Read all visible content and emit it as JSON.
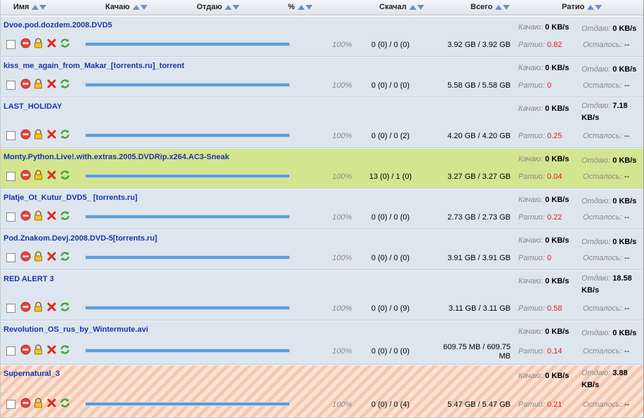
{
  "header": {
    "name": "Имя",
    "down": "Качаю",
    "up": "Отдаю",
    "pct": "%",
    "done": "Скачал",
    "total": "Всего",
    "ratio": "Ратио"
  },
  "labels": {
    "down": "Качаю:",
    "up": "Отдаю:",
    "ratio": "Ратио:",
    "left": "Осталось:"
  },
  "rows": [
    {
      "name": "Dvoe.pod.dozdem.2008.DVD5",
      "down": "0 KB/s",
      "up": "0 KB/s",
      "pct": "100%",
      "peers": "0 (0) / 0 (0)",
      "size": "3.92 GB / 3.92 GB",
      "ratio": "0.82",
      "left": "--",
      "progress": 1.0
    },
    {
      "name": "kiss_me_again_from_Makar_[torrents.ru]_torrent",
      "down": "0 KB/s",
      "up": "0 KB/s",
      "pct": "100%",
      "peers": "0 (0) / 0 (0)",
      "size": "5.58 GB / 5.58 GB",
      "ratio": "0",
      "left": "--",
      "progress": 1.0
    },
    {
      "name": "LAST_HOLIDAY",
      "down": "0 KB/s",
      "up": "7.18 KB/s",
      "pct": "100%",
      "peers": "0 (0) / 0 (2)",
      "size": "4.20 GB / 4.20 GB",
      "ratio": "0.25",
      "left": "--",
      "progress": 1.0
    },
    {
      "name": "Monty.Python.Live!.with.extras.2005.DVDRip.x264.AC3-Sneak",
      "down": "0 KB/s",
      "up": "0 KB/s",
      "pct": "100%",
      "peers": "13 (0) / 1 (0)",
      "size": "3.27 GB / 3.27 GB",
      "ratio": "0.04",
      "left": "--",
      "progress": 1.0
    },
    {
      "name": "Platje_Ot_Kutur_DVD5_ [torrents.ru]",
      "down": "0 KB/s",
      "up": "0 KB/s",
      "pct": "100%",
      "peers": "0 (0) / 0 (0)",
      "size": "2.73 GB / 2.73 GB",
      "ratio": "0.22",
      "left": "--",
      "progress": 1.0
    },
    {
      "name": "Pod.Znakom.Devj.2008.DVD-5[torrents.ru]",
      "down": "0 KB/s",
      "up": "0 KB/s",
      "pct": "100%",
      "peers": "0 (0) / 0 (0)",
      "size": "3.91 GB / 3.91 GB",
      "ratio": "0",
      "left": "--",
      "progress": 1.0
    },
    {
      "name": "RED ALERT 3",
      "down": "0 KB/s",
      "up": "18.58 KB/s",
      "pct": "100%",
      "peers": "0 (0) / 0 (9)",
      "size": "3.11 GB / 3.11 GB",
      "ratio": "0.58",
      "left": "--",
      "progress": 1.0
    },
    {
      "name": "Revolution_OS_rus_by_Wintermute.avi",
      "down": "0 KB/s",
      "up": "0 KB/s",
      "pct": "100%",
      "peers": "0 (0) / 0 (0)",
      "size": "609.75 MB / 609.75 MB",
      "ratio": "0.14",
      "left": "--",
      "progress": 1.0
    },
    {
      "name": "Supernatural_3",
      "down": "0 KB/s",
      "up": "3.88 KB/s",
      "pct": "100%",
      "peers": "0 (0) / 0 (4)",
      "size": "5.47 GB / 5.47 GB",
      "ratio": "0.21",
      "left": "--",
      "progress": 1.0
    }
  ]
}
